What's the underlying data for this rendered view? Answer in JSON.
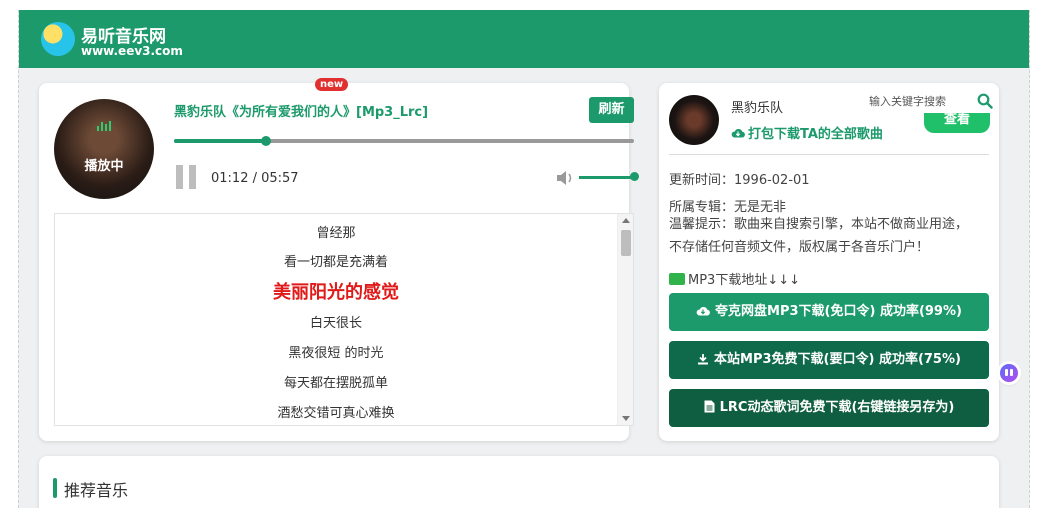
{
  "header": {
    "site_name": "易听音乐网",
    "site_url": "www.eev3.com"
  },
  "player": {
    "status_text": "播放中",
    "song_title": "黑豹乐队《为所有爱我们的人》[Mp3_Lrc]",
    "new_badge": "new",
    "refresh_label": "刷新",
    "current_time": "01:12",
    "total_time": "05:57",
    "time_display": "01:12 / 05:57",
    "progress_fraction": 0.2,
    "volume_fraction": 1.0
  },
  "lyrics": {
    "lines": [
      "曾经那",
      "看一切都是充满着",
      "美丽阳光的感觉",
      "白天很长",
      "黑夜很短 的时光",
      "每天都在摆脱孤单",
      "酒愁交错可真心难换"
    ],
    "active_index": 2
  },
  "info": {
    "artist_name": "黑豹乐队",
    "search_placeholder": "输入关键字搜索",
    "download_all_label": "打包下载TA的全部歌曲",
    "view_label": "查看",
    "update_time": "更新时间：1996-02-01",
    "album": "所属专辑：无是无非",
    "tip": "温馨提示：歌曲来自搜索引擎，本站不做商业用途，不存储任何音频文件，版权属于各音乐门户！",
    "mp3_addr_label": "MP3下载地址↓↓↓",
    "buttons": [
      {
        "label": "夸克网盘MP3下载(免口令) 成功率(99%)",
        "icon": "cloud-download-icon",
        "color": "#1d9a6c"
      },
      {
        "label": "本站MP3免费下载(要口令) 成功率(75%)",
        "icon": "download-icon",
        "color": "#0f6a4b"
      },
      {
        "label": "LRC动态歌词免费下载(右键链接另存为)",
        "icon": "file-icon",
        "color": "#0f5e41"
      }
    ]
  },
  "recommend": {
    "title": "推荐音乐"
  },
  "colors": {
    "brand": "#1d9a6c",
    "active_lyric": "#e01919",
    "new_badge": "#e03030"
  }
}
